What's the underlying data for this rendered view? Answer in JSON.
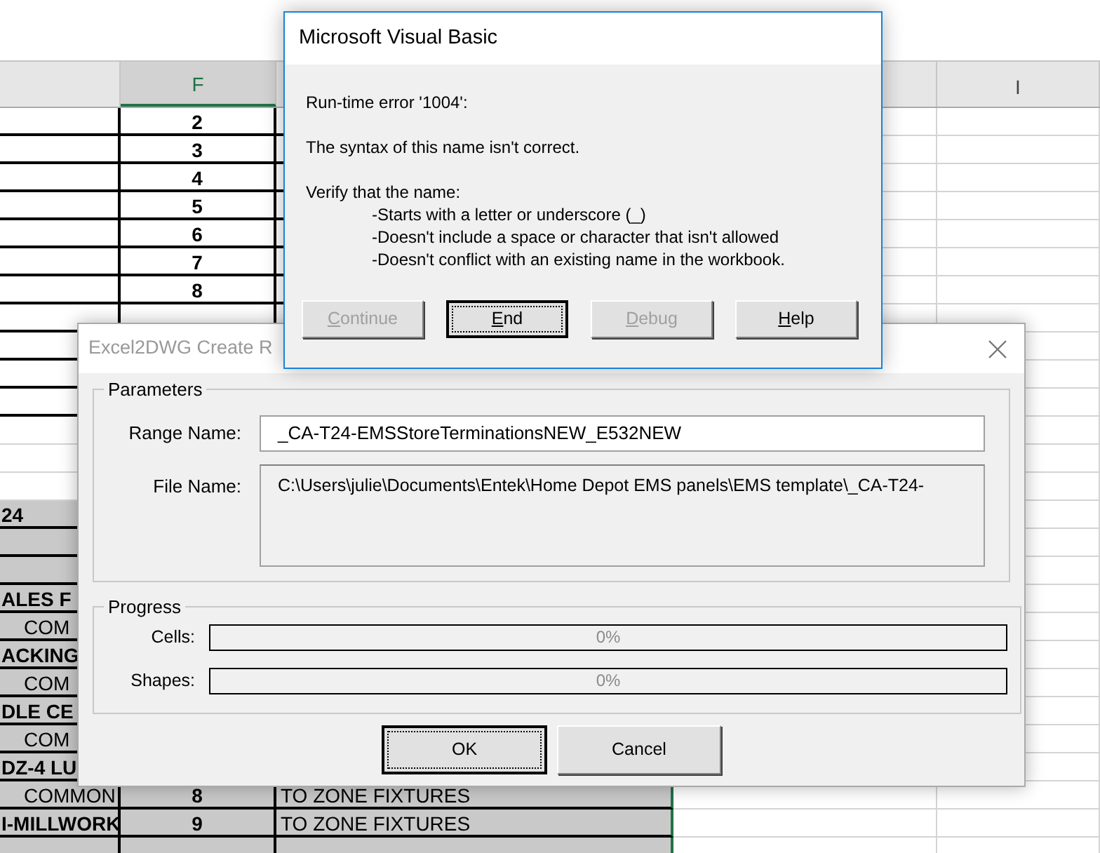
{
  "sheet": {
    "columns": [
      {},
      {
        "label": "F",
        "selected": true
      },
      {},
      {},
      {
        "label": "I",
        "selected": false
      }
    ],
    "rows": [
      {
        "kind": "bordered",
        "f": "2"
      },
      {
        "kind": "bordered",
        "f": "3"
      },
      {
        "kind": "bordered",
        "f": "4"
      },
      {
        "kind": "bordered",
        "f": "5"
      },
      {
        "kind": "bordered",
        "f": "6"
      },
      {
        "kind": "bordered",
        "f": "7"
      },
      {
        "kind": "bordered",
        "f": "8"
      },
      {
        "kind": "bordered"
      },
      {
        "kind": "bordered"
      },
      {
        "kind": "bordered"
      },
      {
        "kind": "bordered"
      },
      {
        "kind": "blank"
      },
      {
        "kind": "blank"
      },
      {
        "kind": "blank"
      },
      {
        "kind": "group",
        "a": "24"
      },
      {
        "kind": "filler"
      },
      {
        "kind": "filler"
      },
      {
        "kind": "group",
        "a": "ALES F"
      },
      {
        "kind": "item",
        "a": "COM"
      },
      {
        "kind": "group",
        "a": "ACKING"
      },
      {
        "kind": "item",
        "a": "COM"
      },
      {
        "kind": "group",
        "a": "DLE CE"
      },
      {
        "kind": "item",
        "a": "COM"
      },
      {
        "kind": "group",
        "a": "DZ-4 LU"
      },
      {
        "kind": "item",
        "a": "COMMON",
        "f": "8",
        "g": "TO ZONE FIXTURES"
      },
      {
        "kind": "group",
        "a": "I-MILLWORK",
        "f": "9",
        "g": "TO ZONE FIXTURES"
      },
      {
        "kind": "filler"
      }
    ]
  },
  "converter_dialog": {
    "title": "Excel2DWG Create R",
    "active": false,
    "parameters": {
      "title": "Parameters",
      "range_label": "Range Name:",
      "range_value": "_CA-T24-EMSStoreTerminationsNEW_E532NEW",
      "file_label": "File Name:",
      "file_value": "C:\\Users\\julie\\Documents\\Entek\\Home Depot EMS panels\\EMS template\\_CA-T24-"
    },
    "progress": {
      "title": "Progress",
      "bars": [
        {
          "label": "Cells:",
          "level": 0,
          "reading": "0%"
        },
        {
          "label": "Shapes:",
          "level": 0,
          "reading": "0%"
        }
      ]
    },
    "buttons": [
      {
        "label": "OK",
        "default": true
      },
      {
        "label": "Cancel",
        "default": false
      }
    ]
  },
  "error_dialog": {
    "title": "Microsoft Visual Basic",
    "active": true,
    "message": [
      {
        "text": "Run-time error '1004':"
      },
      {
        "text": "The syntax of this name isn't correct."
      },
      {
        "text": "Verify that the name:",
        "items": [
          "-Starts with a letter or underscore (_)",
          "-Doesn't include a space or character that isn't allowed",
          "-Doesn't conflict with an existing name in the workbook."
        ]
      }
    ],
    "buttons": [
      {
        "label": "Continue",
        "disabled": true,
        "default": false,
        "mnemonic": true
      },
      {
        "label": "End",
        "disabled": false,
        "default": true,
        "mnemonic": true
      },
      {
        "label": "Debug",
        "disabled": true,
        "default": false,
        "mnemonic": true
      },
      {
        "label": "Help",
        "disabled": false,
        "default": false,
        "mnemonic": true
      }
    ]
  }
}
